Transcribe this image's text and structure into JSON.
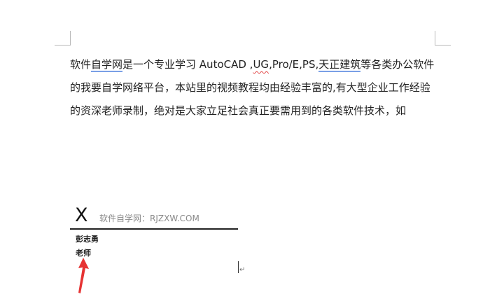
{
  "document": {
    "line1": {
      "seg1": "软件",
      "seg2": "自学网",
      "seg3": "是一个专业学习 AutoCAD ,",
      "seg4": "UG",
      "seg5": ",Pro/E,PS,",
      "seg6": "天正",
      "seg7": "建筑",
      "seg8": "等各类办公软件"
    },
    "line2": "的我要自学网络平台，本站里的视频教程均由经验丰富的,有大型企业工作经验",
    "line3": "的资深老师录制，绝对是大家立足社会真正要需用到的各类软件技术，如"
  },
  "signature": {
    "mark": "X",
    "caption": "软件自学网：RJZXW.COM",
    "name": "彭志勇",
    "title": "老师"
  },
  "editor": {
    "paragraph_mark": "↵"
  },
  "colors": {
    "underline_blue": "#7a9fe6",
    "spell_red": "#e24848",
    "arrow_red": "#e63333"
  }
}
